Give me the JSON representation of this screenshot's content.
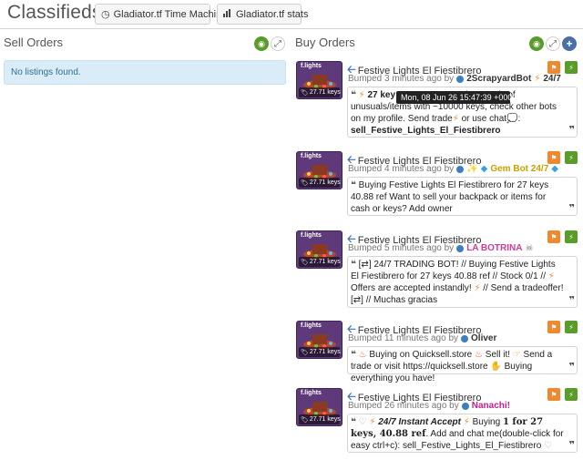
{
  "header": {
    "brand": "Classifieds",
    "time_machine_label": "Gladiator.tf Time Machine",
    "stats_label": "Gladiator.tf stats"
  },
  "sell": {
    "title": "Sell Orders",
    "empty_text": "No listings found."
  },
  "buy": {
    "title": "Buy Orders",
    "tooltip": "Mon, 08 Jun 26 15:47:39 +0000",
    "listings": [
      {
        "item_name": "Festive Lights El Fiestibrero",
        "item_quality": "f.lights",
        "price": "27.71 keys",
        "bumped": "Bumped 3 minutes ago by",
        "owner": "2ScrapyardBot",
        "owner_suffix": "24/7",
        "text_start": "27 key",
        "text_cont": "g thousands of unusuals/items with ~10000 keys, check other bots on my profile. Send",
        "trade": "trade",
        "or_use": "or  use",
        "chat": "chat",
        "colon": ":",
        "command": "sell_Festive_Lights_El_Fiestibrero"
      },
      {
        "item_name": "Festive Lights El Fiestibrero",
        "item_quality": "f.lights",
        "price": "27.71 keys",
        "bumped": "Bumped 4 minutes ago by",
        "owner": "Gem Bot 24/7",
        "text": "Buying Festive Lights El Fiestibrero for 27 keys 40.88 ref Want to sell your backpack or items for cash or keys? Add owner"
      },
      {
        "item_name": "Festive Lights El Fiestibrero",
        "item_quality": "f.lights",
        "price": "27.71 keys",
        "bumped": "Bumped 5 minutes ago by",
        "owner": "LA BOTRINA",
        "text": "[⇄] 24/7 TRADING BOT! // Buying Festive Lights El Fiestibrero for 27 keys 40.88 ref // Stock 0/1 //",
        "text_b": "Offers are accepted instandly!",
        "text_c": "// Send a tradeoffer! [⇄] // Muchas gracias"
      },
      {
        "item_name": "Festive Lights El Fiestibrero",
        "item_quality": "f.lights",
        "price": "27.71 keys",
        "bumped": "Bumped 11 minutes ago by",
        "owner": "Oliver",
        "text_a": "Buying on Quicksell.store",
        "text_b": "Sell it!",
        "text_c": "Send a trade or visit https://quicksell.store",
        "text_d": "Buying everything you have!"
      },
      {
        "item_name": "Festive Lights El Fiestibrero",
        "item_quality": "f.lights",
        "price": "27.71 keys",
        "bumped": "Bumped 26 minutes ago by",
        "owner": "Nanachi!",
        "text_bold": "24/7 Instant Accept",
        "text_buying": "Buying",
        "text_amount": "1 for 27 keys, 40.88 ref",
        "text_rest": ". Add and chat me(double-click for easy ctrl+c): sell_Festive_Lights_El_Fiestibrero"
      }
    ]
  },
  "colors": {
    "accent_blue": "#3a72b0",
    "green": "#5a9c2a",
    "orange": "#f0882d",
    "alert_bg": "#d9ecf7"
  }
}
